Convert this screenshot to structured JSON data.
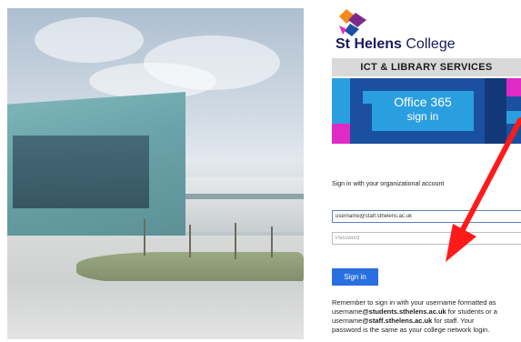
{
  "brand": {
    "college_name_bold": "St Helens",
    "college_name_regular": " College",
    "department": "ICT & LIBRARY SERVICES",
    "colors": {
      "navy": "#1a1a5e",
      "banner_blue": "#1b4fa0",
      "banner_light": "#2a9fe0",
      "magenta": "#e02ac6",
      "logo_orange": "#f28a1b",
      "logo_purple": "#7b2a8c"
    }
  },
  "banner": {
    "line1": "Office 365",
    "line2": "sign in"
  },
  "login": {
    "prompt": "Sign in with your organizational account",
    "username_value": "username@staff.sthelens.ac.uk",
    "password_placeholder": "Password",
    "signin_label": "Sign in",
    "button_color": "#2a6fe0"
  },
  "help": {
    "line1": "Remember to sign in with your username formatted as",
    "line2_prefix": "username",
    "line2_bold": "@students.sthelens.ac.uk",
    "line2_suffix": " for students or a",
    "line3_prefix": "username",
    "line3_bold": "@staff.sthelens.ac.uk",
    "line3_suffix": " for staff. Your",
    "line4": "password is the same as your college network login."
  },
  "annotation": {
    "arrow_color": "#ff1a1a",
    "icon": "arrow-pointing-icon"
  }
}
